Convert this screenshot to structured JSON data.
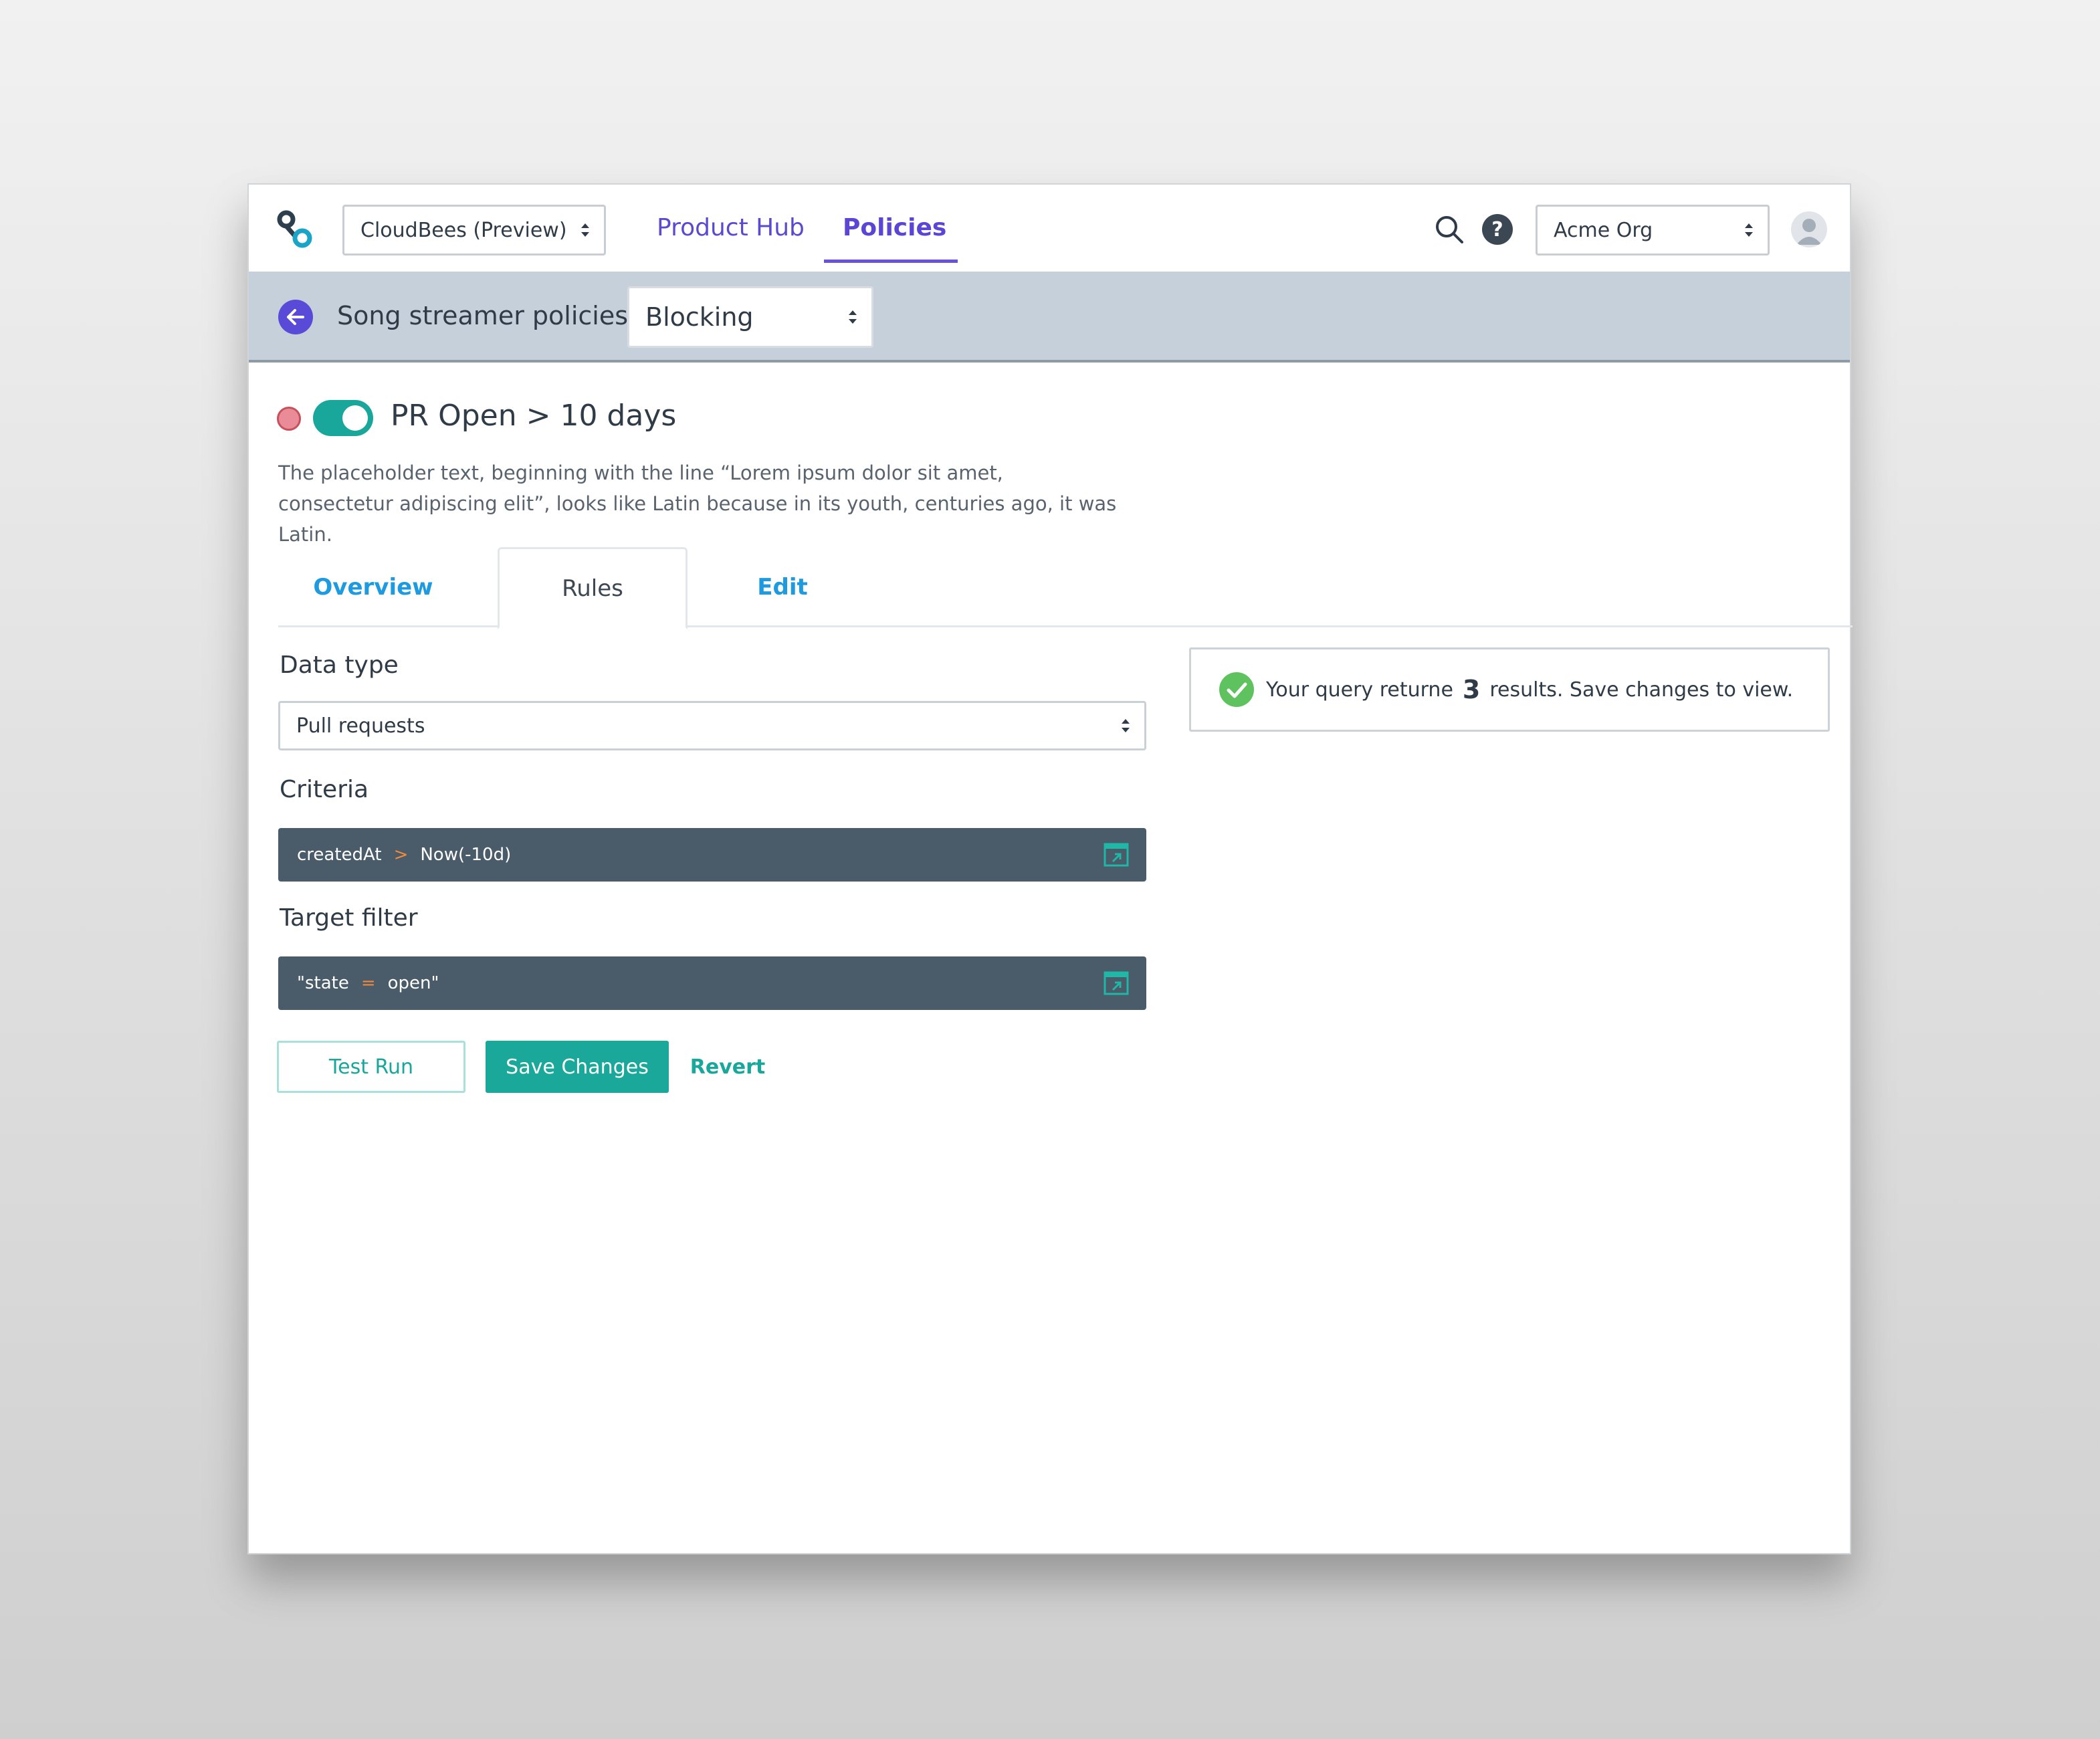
{
  "header": {
    "product_select": "CloudBees (Preview)",
    "nav": [
      {
        "label": "Product Hub",
        "active": false
      },
      {
        "label": "Policies",
        "active": true
      }
    ],
    "org_select": "Acme Org",
    "help_glyph": "?"
  },
  "subheader": {
    "title": "Song streamer policies",
    "mode_select": "Blocking"
  },
  "policy": {
    "title": "PR Open > 10 days",
    "description": "The placeholder text, beginning with the line “Lorem ipsum dolor sit amet, consectetur adipiscing elit”, looks like Latin because in its youth, centuries ago, it was Latin.",
    "enabled": true,
    "status_color": "#ea8c98"
  },
  "tabs": [
    {
      "label": "Overview",
      "active": false
    },
    {
      "label": "Rules",
      "active": true
    },
    {
      "label": "Edit",
      "active": false
    }
  ],
  "form": {
    "data_type_label": "Data type",
    "data_type_value": "Pull requests",
    "criteria_label": "Criteria",
    "criteria": {
      "left": "createdAt",
      "op": ">",
      "right": "Now(-10d)"
    },
    "target_label": "Target filter",
    "target": {
      "left": "\"state",
      "op": "=",
      "right": "open\""
    }
  },
  "actions": {
    "test_run": "Test Run",
    "save": "Save Changes",
    "revert": "Revert"
  },
  "result": {
    "prefix": "Your query returne",
    "count": "3",
    "suffix": "results. Save changes to view."
  },
  "colors": {
    "accent_purple": "#5b45d6",
    "teal": "#18a79a",
    "subheader_bg": "#c5d0da",
    "code_bg": "#4a5b69",
    "operator": "#f08a3c",
    "success": "#5ec35e"
  },
  "icons": [
    "app-logo",
    "search-icon",
    "help-icon",
    "avatar-icon",
    "back-arrow-icon",
    "expand-icon",
    "check-icon"
  ]
}
